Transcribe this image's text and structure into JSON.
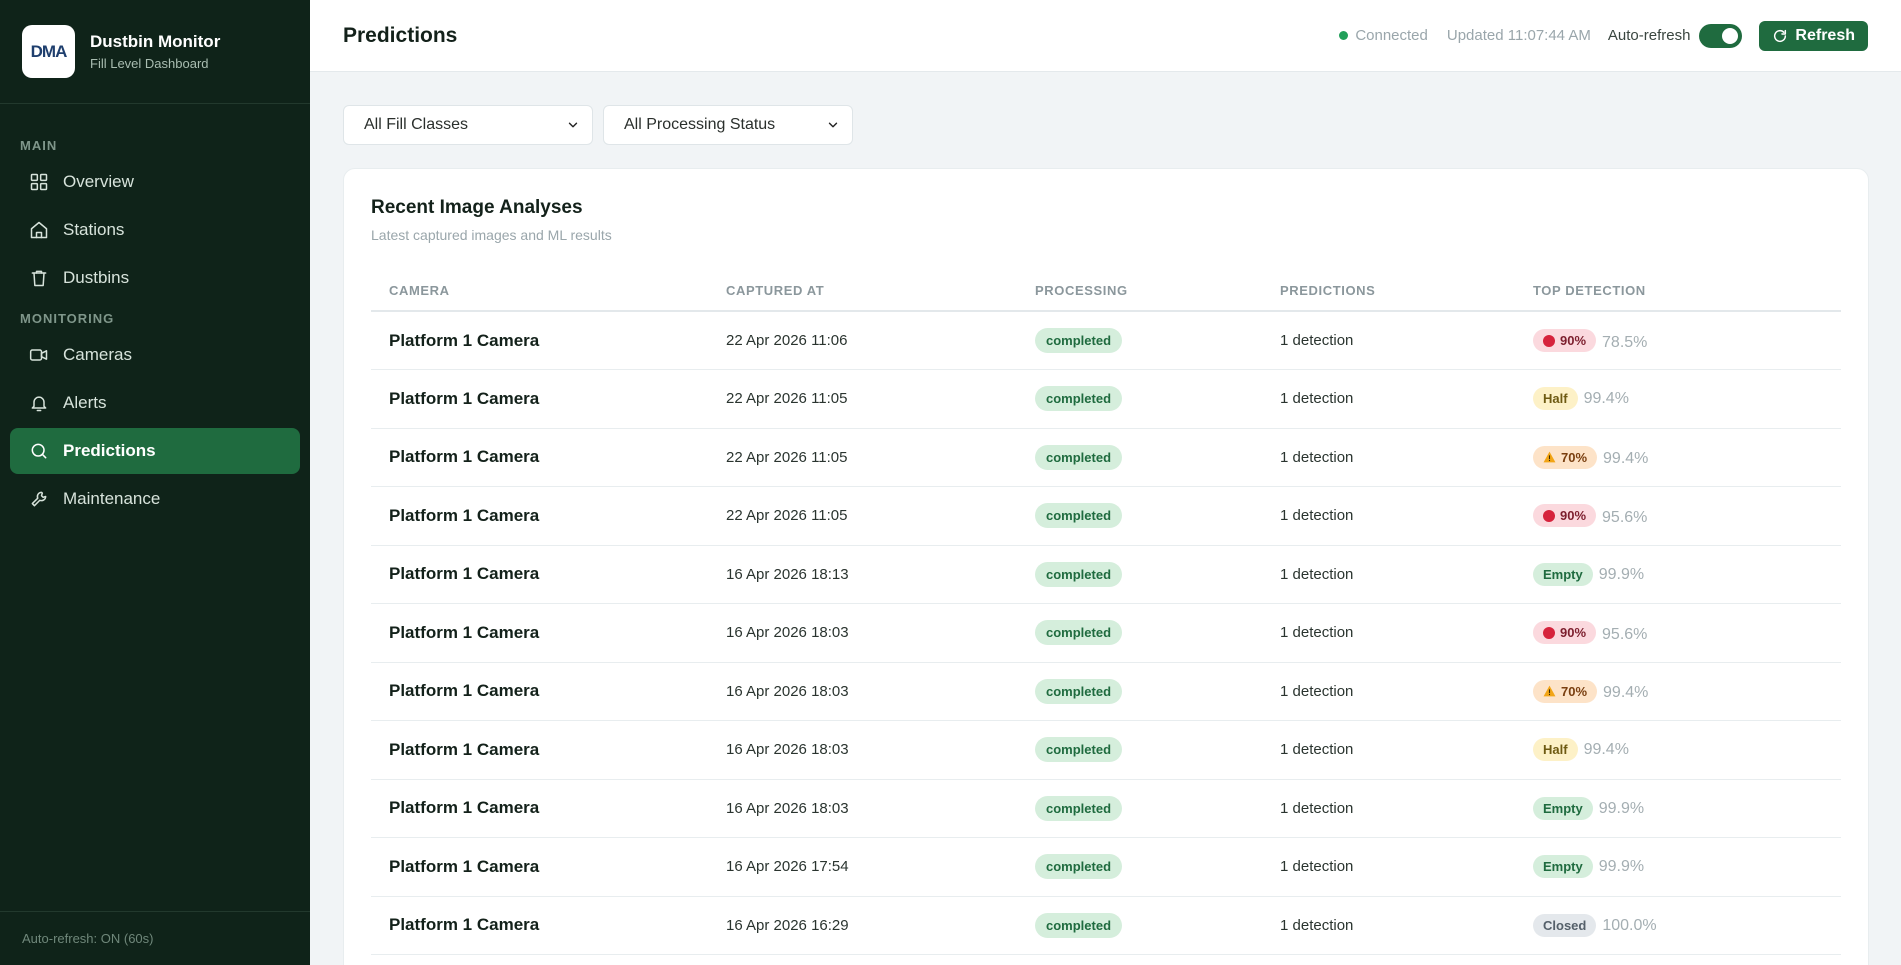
{
  "brand": {
    "logo_text": "DMA",
    "title": "Dustbin Monitor",
    "subtitle": "Fill Level Dashboard"
  },
  "sidebar": {
    "sections": {
      "main": "MAIN",
      "monitoring": "MONITORING"
    },
    "items": [
      {
        "label": "Overview",
        "icon": "grid-icon"
      },
      {
        "label": "Stations",
        "icon": "home-icon"
      },
      {
        "label": "Dustbins",
        "icon": "trash-icon"
      },
      {
        "label": "Cameras",
        "icon": "video-icon"
      },
      {
        "label": "Alerts",
        "icon": "bell-icon"
      },
      {
        "label": "Predictions",
        "icon": "search-icon",
        "active": true
      },
      {
        "label": "Maintenance",
        "icon": "wrench-icon"
      }
    ],
    "footer": "Auto-refresh: ON (60s)"
  },
  "header": {
    "title": "Predictions",
    "connection": "Connected",
    "updated": "Updated 11:07:44 AM",
    "auto_refresh_label": "Auto-refresh",
    "auto_refresh_on": true,
    "refresh_label": "Refresh"
  },
  "filters": {
    "fill_class": "All Fill Classes",
    "processing_status": "All Processing Status"
  },
  "card": {
    "title": "Recent Image Analyses",
    "subtitle": "Latest captured images and ML results"
  },
  "table": {
    "columns": [
      "Camera",
      "Captured At",
      "Processing",
      "Predictions",
      "Top Detection"
    ],
    "rows": [
      {
        "camera": "Platform 1 Camera",
        "captured": "22 Apr 2026 11:06",
        "processing": "completed",
        "predictions": "1 detection",
        "detection": "90%",
        "kind": "red",
        "confidence": "78.5%"
      },
      {
        "camera": "Platform 1 Camera",
        "captured": "22 Apr 2026 11:05",
        "processing": "completed",
        "predictions": "1 detection",
        "detection": "Half",
        "kind": "yellow",
        "confidence": "99.4%"
      },
      {
        "camera": "Platform 1 Camera",
        "captured": "22 Apr 2026 11:05",
        "processing": "completed",
        "predictions": "1 detection",
        "detection": "70%",
        "kind": "orange",
        "confidence": "99.4%"
      },
      {
        "camera": "Platform 1 Camera",
        "captured": "22 Apr 2026 11:05",
        "processing": "completed",
        "predictions": "1 detection",
        "detection": "90%",
        "kind": "red",
        "confidence": "95.6%"
      },
      {
        "camera": "Platform 1 Camera",
        "captured": "16 Apr 2026 18:13",
        "processing": "completed",
        "predictions": "1 detection",
        "detection": "Empty",
        "kind": "green",
        "confidence": "99.9%"
      },
      {
        "camera": "Platform 1 Camera",
        "captured": "16 Apr 2026 18:03",
        "processing": "completed",
        "predictions": "1 detection",
        "detection": "90%",
        "kind": "red",
        "confidence": "95.6%"
      },
      {
        "camera": "Platform 1 Camera",
        "captured": "16 Apr 2026 18:03",
        "processing": "completed",
        "predictions": "1 detection",
        "detection": "70%",
        "kind": "orange",
        "confidence": "99.4%"
      },
      {
        "camera": "Platform 1 Camera",
        "captured": "16 Apr 2026 18:03",
        "processing": "completed",
        "predictions": "1 detection",
        "detection": "Half",
        "kind": "yellow",
        "confidence": "99.4%"
      },
      {
        "camera": "Platform 1 Camera",
        "captured": "16 Apr 2026 18:03",
        "processing": "completed",
        "predictions": "1 detection",
        "detection": "Empty",
        "kind": "green",
        "confidence": "99.9%"
      },
      {
        "camera": "Platform 1 Camera",
        "captured": "16 Apr 2026 17:54",
        "processing": "completed",
        "predictions": "1 detection",
        "detection": "Empty",
        "kind": "green",
        "confidence": "99.9%"
      },
      {
        "camera": "Platform 1 Camera",
        "captured": "16 Apr 2026 16:29",
        "processing": "completed",
        "predictions": "1 detection",
        "detection": "Closed",
        "kind": "gray",
        "confidence": "100.0%"
      }
    ]
  },
  "colors": {
    "sidebar_bg": "#0f2319",
    "accent": "#1f6b3f",
    "connected": "#22a05a"
  }
}
